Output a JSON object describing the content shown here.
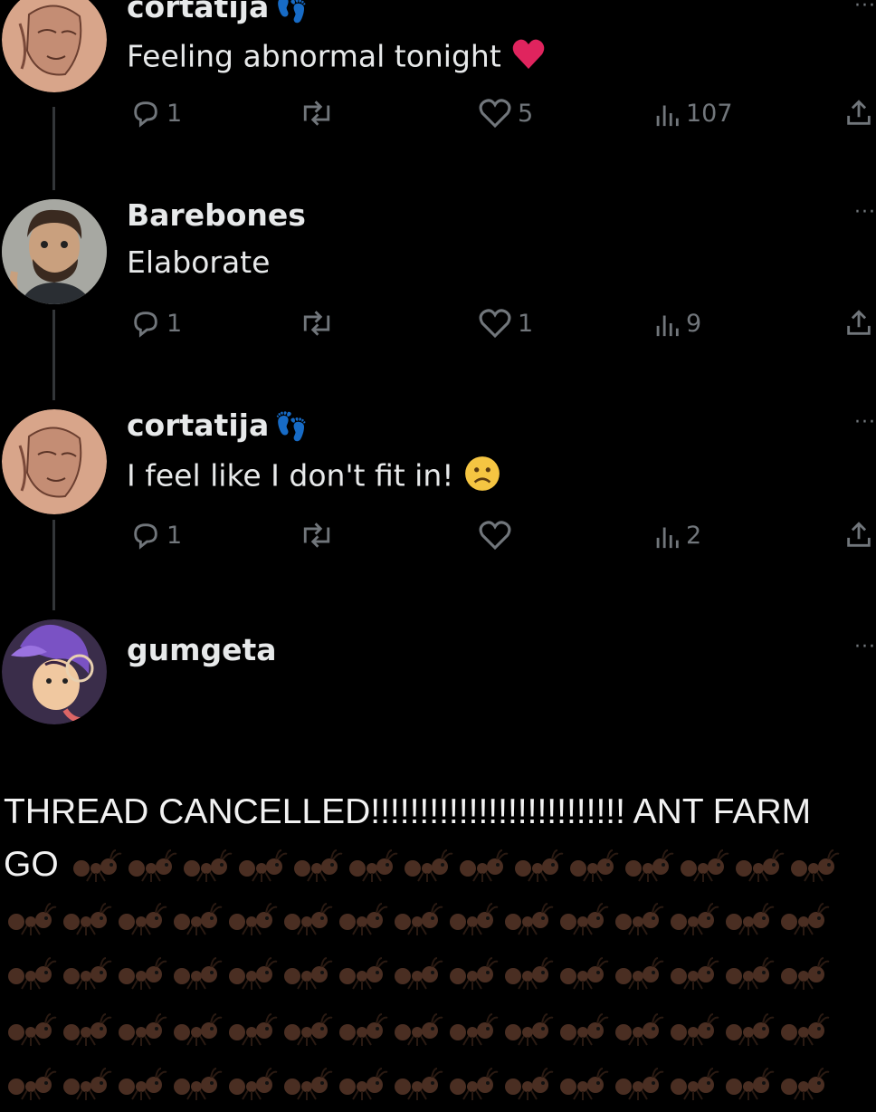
{
  "posts": [
    {
      "username": "cortatija",
      "username_icon": "footprints-icon",
      "text": "Feeling abnormal tonight",
      "emoji": "red-heart-emoji",
      "replies": "1",
      "likes": "5",
      "views": "107"
    },
    {
      "username": "Barebones",
      "text": "Elaborate",
      "replies": "1",
      "likes": "1",
      "views": "9"
    },
    {
      "username": "cortatija",
      "username_icon": "footprints-icon",
      "text": "I feel like I don't fit in!",
      "emoji": "frowning-face-emoji",
      "replies": "1",
      "likes": "",
      "views": "2"
    },
    {
      "username": "gumgeta"
    }
  ],
  "more_label": "···",
  "caption": {
    "line1": "THREAD CANCELLED!!!!!!!!!!!!!!!!!!!!!!!!!! ANT FARM",
    "line2_prefix": "GO",
    "emoji": "ant-emoji"
  },
  "colors": {
    "background": "#000000",
    "text": "#e7e9ea",
    "muted": "#71767b",
    "heart": "#e0245e"
  }
}
